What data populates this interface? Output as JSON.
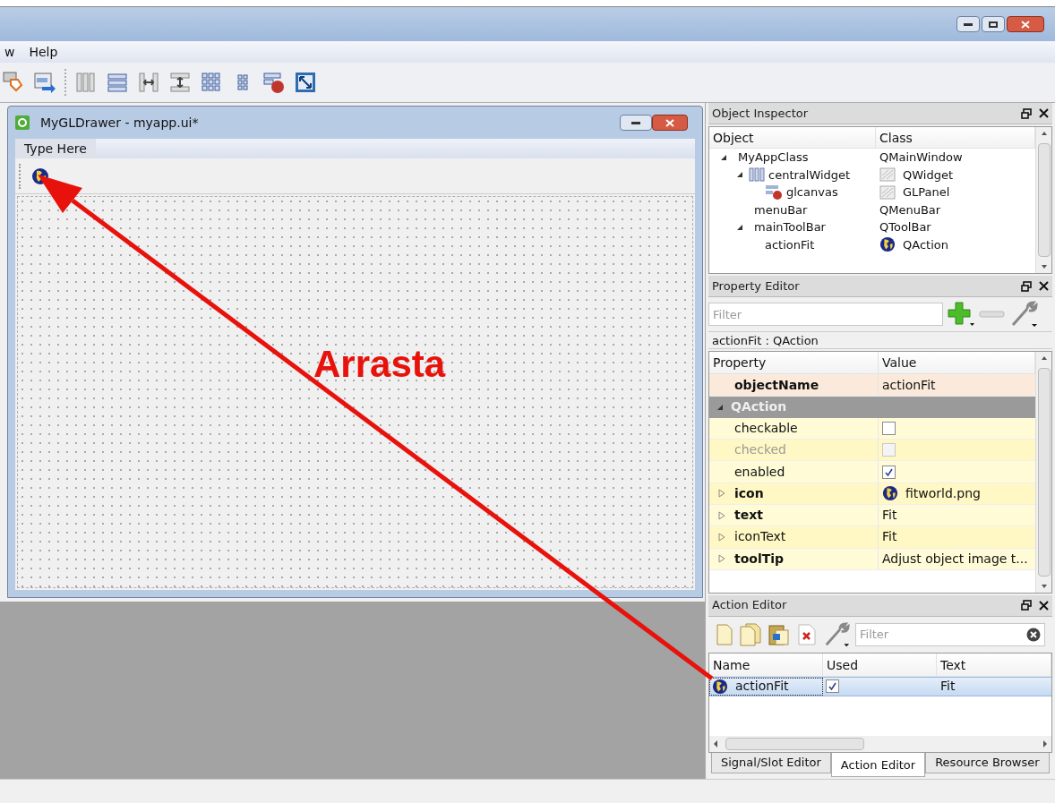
{
  "menu_bar": [
    {
      "label": "w"
    },
    {
      "label": "Help"
    }
  ],
  "form_window": {
    "title": "MyGLDrawer - myapp.ui*",
    "menu_placeholder": "Type Here"
  },
  "annotation": {
    "label": "Arrasta"
  },
  "object_inspector": {
    "title": "Object Inspector",
    "columns": [
      "Object",
      "Class"
    ],
    "tree": [
      {
        "name": "MyAppClass",
        "class": "QMainWindow",
        "kind": "plain",
        "expanded": true,
        "children": [
          {
            "name": "centralWidget",
            "class": "QWidget",
            "kind": "layout",
            "expanded": true,
            "children": [
              {
                "name": "glcanvas",
                "class": "GLPanel",
                "kind": "canvas"
              }
            ]
          },
          {
            "name": "menuBar",
            "class": "QMenuBar",
            "kind": "plain"
          },
          {
            "name": "mainToolBar",
            "class": "QToolBar",
            "kind": "plain",
            "expanded": true,
            "children": [
              {
                "name": "actionFit",
                "class": "QAction",
                "kind": "action"
              }
            ]
          }
        ]
      }
    ]
  },
  "property_editor": {
    "title": "Property Editor",
    "filter_placeholder": "Filter",
    "object_label": "actionFit : QAction",
    "columns": [
      "Property",
      "Value"
    ],
    "rows": [
      {
        "kind": "text",
        "name": "objectName",
        "value": "actionFit",
        "bold": true,
        "color": "#fbeadb"
      },
      {
        "kind": "group",
        "name": "QAction",
        "expanded": true,
        "color": "#9a9a9a"
      },
      {
        "kind": "checkbox",
        "name": "checkable",
        "checked": false,
        "disabled": false,
        "color": "#fffbd6"
      },
      {
        "kind": "checkbox",
        "name": "checked",
        "checked": false,
        "disabled": true,
        "color": "#fff8c4"
      },
      {
        "kind": "checkbox",
        "name": "enabled",
        "checked": true,
        "disabled": false,
        "color": "#fffbd6"
      },
      {
        "kind": "icon",
        "name": "icon",
        "value": "fitworld.png",
        "bold": true,
        "expandable": true,
        "color": "#fff8c4"
      },
      {
        "kind": "text",
        "name": "text",
        "value": "Fit",
        "bold": true,
        "expandable": true,
        "color": "#fffbd6"
      },
      {
        "kind": "text",
        "name": "iconText",
        "value": "Fit",
        "bold": false,
        "expandable": true,
        "color": "#fff8c4"
      },
      {
        "kind": "text",
        "name": "toolTip",
        "value": "Adjust object image t...",
        "bold": true,
        "expandable": true,
        "color": "#fffbd6"
      }
    ]
  },
  "action_editor": {
    "title": "Action Editor",
    "filter_placeholder": "Filter",
    "columns": [
      "Name",
      "Used",
      "Text"
    ],
    "rows": [
      {
        "name": "actionFit",
        "used": true,
        "text": "Fit",
        "selected": true
      }
    ]
  },
  "bottom_tabs": [
    {
      "label": "Signal/Slot Editor",
      "selected": false
    },
    {
      "label": "Action Editor",
      "selected": true
    },
    {
      "label": "Resource Browser",
      "selected": false
    }
  ]
}
